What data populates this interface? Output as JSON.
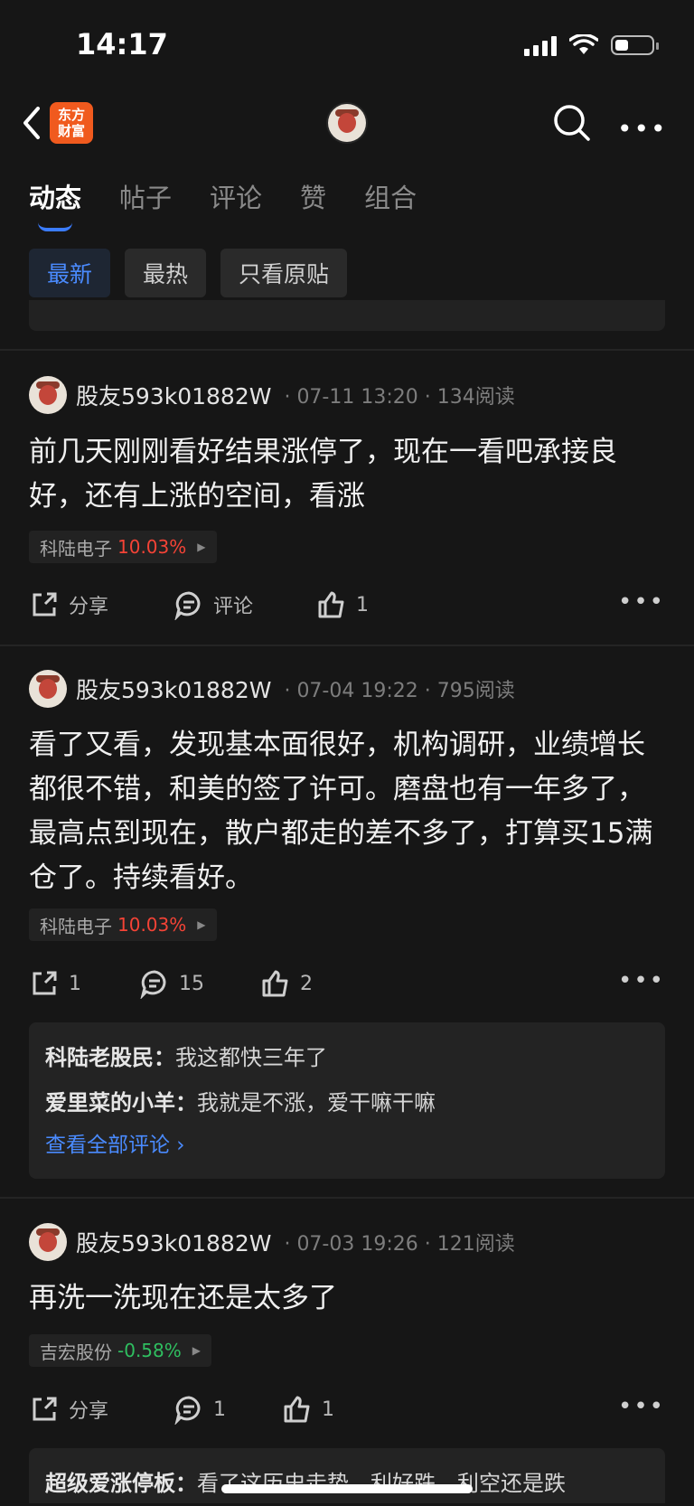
{
  "status": {
    "time": "14:17"
  },
  "header": {
    "logo_text_line1": "东方",
    "logo_text_line2": "财富"
  },
  "tabs": [
    {
      "label": "动态",
      "active": true
    },
    {
      "label": "帖子"
    },
    {
      "label": "评论"
    },
    {
      "label": "赞"
    },
    {
      "label": "组合"
    }
  ],
  "filters": [
    {
      "label": "最新",
      "active": true
    },
    {
      "label": "最热"
    },
    {
      "label": "只看原贴"
    }
  ],
  "posts": [
    {
      "user": "股友593k01882W",
      "meta": "· 07-11 13:20 · 134阅读",
      "body": "前几天刚刚看好结果涨停了，现在一看吧承接良好，还有上涨的空间，看涨",
      "stock_name": "科陆电子",
      "stock_change": "10.03%",
      "share": "分享",
      "comment": "评论",
      "like": "1"
    },
    {
      "user": "股友593k01882W",
      "meta": "· 07-04 19:22 · 795阅读",
      "body": "看了又看，发现基本面很好，机构调研，业绩增长都很不错，和美的签了许可。磨盘也有一年多了，最高点到现在，散户都走的差不多了，打算买15满仓了。持续看好。",
      "stock_name": "科陆电子",
      "stock_change": "10.03%",
      "share": "1",
      "comment": "15",
      "like": "2",
      "replies": [
        {
          "name": "科陆老股民：",
          "text": "我这都快三年了"
        },
        {
          "name": "爱里菜的小羊：",
          "text": "我就是不涨，爱干嘛干嘛"
        }
      ],
      "view_all": "查看全部评论 ›"
    },
    {
      "user": "股友593k01882W",
      "meta": "· 07-03 19:26 · 121阅读",
      "body": "再洗一洗现在还是太多了",
      "stock_name": "吉宏股份",
      "stock_change": "-0.58%",
      "share": "分享",
      "comment": "1",
      "like": "1",
      "replies": [
        {
          "name": "超级爱涨停板：",
          "text": "看了这历史走势，利好跌，利空还是跌"
        }
      ]
    }
  ],
  "colors": {
    "accent": "#3b7cff",
    "up": "#f44336",
    "down": "#2fbf60",
    "background": "#161616"
  }
}
